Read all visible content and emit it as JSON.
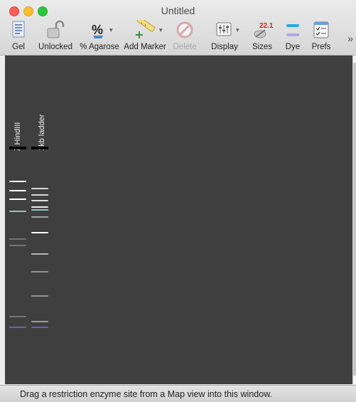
{
  "window": {
    "title": "Untitled"
  },
  "toolbar": {
    "items": [
      {
        "label": "Gel",
        "icon": "gel-document-icon",
        "dropdown": false,
        "enabled": true
      },
      {
        "label": "Unlocked",
        "icon": "padlock-open-icon",
        "dropdown": false,
        "enabled": true
      },
      {
        "label": "% Agarose",
        "icon": "percent-flask-icon",
        "dropdown": true,
        "enabled": true
      },
      {
        "label": "Add Marker",
        "icon": "ruler-marker-icon",
        "dropdown": true,
        "enabled": true
      },
      {
        "label": "Delete",
        "icon": "no-entry-icon",
        "dropdown": false,
        "enabled": false
      },
      {
        "label": "Display",
        "icon": "display-grid-icon",
        "dropdown": true,
        "enabled": true
      },
      {
        "label": "Sizes",
        "icon": "sizes-badge-icon",
        "dropdown": false,
        "enabled": true
      },
      {
        "label": "Dye",
        "icon": "dye-bands-icon",
        "dropdown": false,
        "enabled": true
      },
      {
        "label": "Prefs",
        "icon": "prefs-checklist-icon",
        "dropdown": false,
        "enabled": true
      }
    ],
    "sizes_badge_text": "22.1",
    "overflow_glyph": "»"
  },
  "gel": {
    "background": "#3f3f3f",
    "lanes": [
      {
        "label": "λ HindIII",
        "bands": [
          {
            "pos": 0.381,
            "intensity": 1.0,
            "color": "#ffffff"
          },
          {
            "pos": 0.409,
            "intensity": 1.0,
            "color": "#ffffff"
          },
          {
            "pos": 0.434,
            "intensity": 1.0,
            "color": "#ffffff"
          },
          {
            "pos": 0.472,
            "intensity": 0.9,
            "color": "#9fd4cc"
          },
          {
            "pos": 0.556,
            "intensity": 0.35,
            "color": "#d0d0d0"
          },
          {
            "pos": 0.576,
            "intensity": 0.35,
            "color": "#d0d0d0"
          },
          {
            "pos": 0.792,
            "intensity": 0.35,
            "color": "#d0d0d0"
          },
          {
            "pos": 0.825,
            "intensity": 0.7,
            "color": "#7a72d8"
          }
        ]
      },
      {
        "label": "1kb ladder",
        "bands": [
          {
            "pos": 0.403,
            "intensity": 0.8,
            "color": "#ffffff"
          },
          {
            "pos": 0.423,
            "intensity": 0.8,
            "color": "#ffffff"
          },
          {
            "pos": 0.44,
            "intensity": 0.85,
            "color": "#ffffff"
          },
          {
            "pos": 0.459,
            "intensity": 0.9,
            "color": "#ffffff"
          },
          {
            "pos": 0.468,
            "intensity": 0.9,
            "color": "#9fd4cc"
          },
          {
            "pos": 0.49,
            "intensity": 0.6,
            "color": "#e6e6e6"
          },
          {
            "pos": 0.537,
            "intensity": 1.0,
            "color": "#ffffff"
          },
          {
            "pos": 0.602,
            "intensity": 0.7,
            "color": "#e6e6e6"
          },
          {
            "pos": 0.656,
            "intensity": 0.55,
            "color": "#d8d8d8"
          },
          {
            "pos": 0.73,
            "intensity": 0.55,
            "color": "#d8d8d8"
          },
          {
            "pos": 0.807,
            "intensity": 0.6,
            "color": "#d8d8d8"
          },
          {
            "pos": 0.825,
            "intensity": 0.7,
            "color": "#7a72d8"
          }
        ]
      }
    ]
  },
  "status": {
    "text": "Drag a restriction enzyme site from a Map view into this window."
  }
}
